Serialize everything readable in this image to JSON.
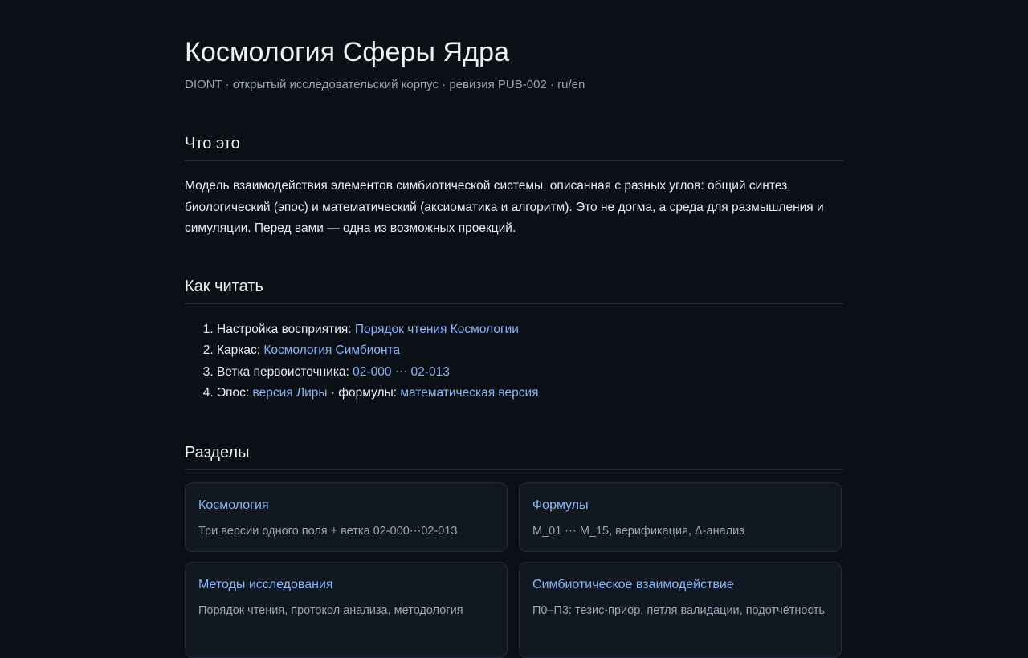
{
  "header": {
    "title": "Космология Сферы Ядра",
    "subtitle": "DIONT · открытый исследовательский корпус · ревизия PUB-002 · ru/en"
  },
  "what": {
    "heading": "Что это",
    "text": "Модель взаимодействия элементов симбиотической системы, описанная с разных углов: общий синтез, биологический (эпос) и математический (аксиоматика и алгоритм). Это не догма, а среда для размышления и симуляции. Перед вами — одна из возможных проекций."
  },
  "how": {
    "heading": "Как читать",
    "items": [
      {
        "prefix": "Настройка восприятия: ",
        "link": "Порядок чтения Космологии"
      },
      {
        "prefix": "Каркас: ",
        "link": "Космология Симбионта"
      },
      {
        "prefix": "Ветка первоисточника: ",
        "link": "02-000 ⋯ 02-013"
      },
      {
        "prefix": "Эпос: ",
        "link": "версия Лиры",
        "middle": " · формулы: ",
        "link2": "математическая версия"
      }
    ]
  },
  "sections": {
    "heading": "Разделы",
    "cards": [
      {
        "title": "Космология",
        "desc": "Три версии одного поля + ветка 02-000⋯02-013"
      },
      {
        "title": "Формулы",
        "desc": "M_01 ⋯ M_15, верификация, Δ-анализ"
      },
      {
        "title": "Методы исследования",
        "desc": "Порядок чтения, протокол анализа, методология"
      },
      {
        "title": "Симбиотическое взаимодействие",
        "desc": "П0–П3: тезис-приор, петля валидации, подотчётность"
      }
    ]
  }
}
